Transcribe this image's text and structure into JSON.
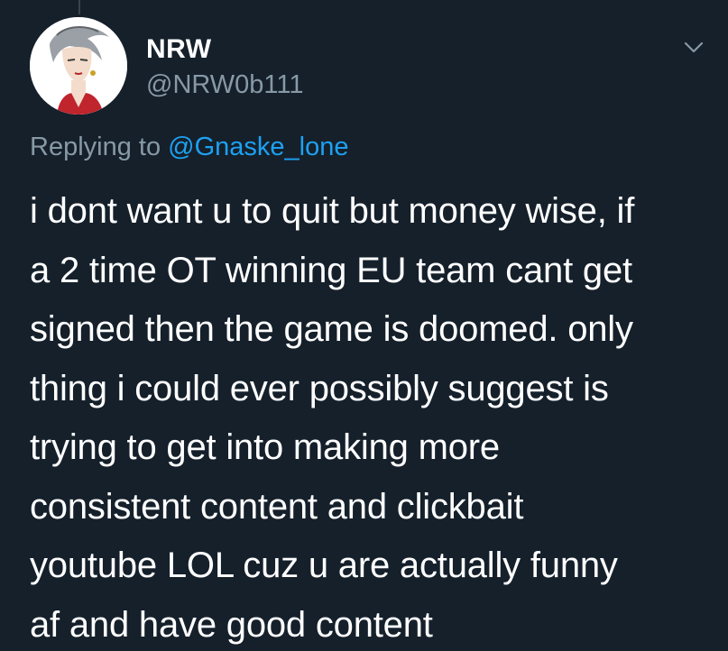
{
  "tweet": {
    "author": {
      "display_name": "NRW",
      "handle": "@NRW0b111",
      "avatar_icon": "anime-character-avatar"
    },
    "menu_icon": "chevron-down-icon",
    "reply": {
      "prefix": "Replying to ",
      "mention": "@Gnaske_lone"
    },
    "body_lines": [
      "i dont want u to quit but money wise, if",
      "a 2 time OT winning EU team cant get",
      "signed then the game is doomed. only",
      "thing i could ever possibly suggest is",
      "trying to get into making more",
      "consistent content and clickbait",
      "youtube LOL cuz u are actually funny",
      "af and have good content"
    ]
  },
  "colors": {
    "background": "#15202b",
    "primary_text": "#ffffff",
    "secondary_text": "#8899a6",
    "link": "#1da1f2",
    "thread_line": "#38444d"
  }
}
